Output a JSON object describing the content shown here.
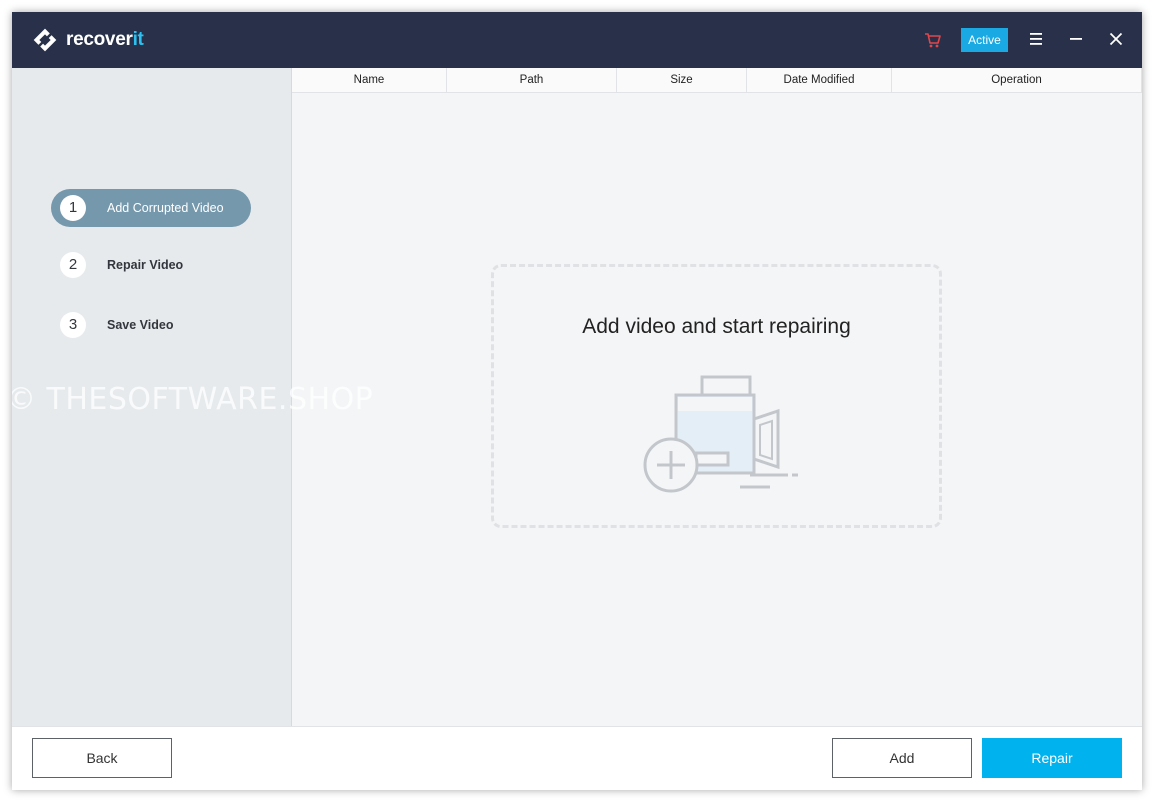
{
  "app": {
    "name_main": "recover",
    "name_accent": "it",
    "active_label": "Active"
  },
  "icons": {
    "cart": "shopping-cart-icon",
    "menu": "hamburger-menu-icon",
    "minimize": "minimize-icon",
    "close": "close-icon",
    "camera": "add-video-camera-icon"
  },
  "colors": {
    "titlebar": "#283149",
    "accent": "#00b3ef",
    "active_step": "#7598ac",
    "cart": "#e0474c"
  },
  "steps": [
    {
      "num": "1",
      "label": "Add Corrupted Video",
      "active": true
    },
    {
      "num": "2",
      "label": "Repair Video",
      "active": false
    },
    {
      "num": "3",
      "label": "Save Video",
      "active": false
    }
  ],
  "watermark": "© THESOFTWARE.SHOP",
  "table": {
    "columns": [
      "Name",
      "Path",
      "Size",
      "Date Modified",
      "Operation"
    ]
  },
  "dropzone": {
    "title": "Add video and start repairing"
  },
  "footer": {
    "back_label": "Back",
    "add_label": "Add",
    "repair_label": "Repair"
  }
}
